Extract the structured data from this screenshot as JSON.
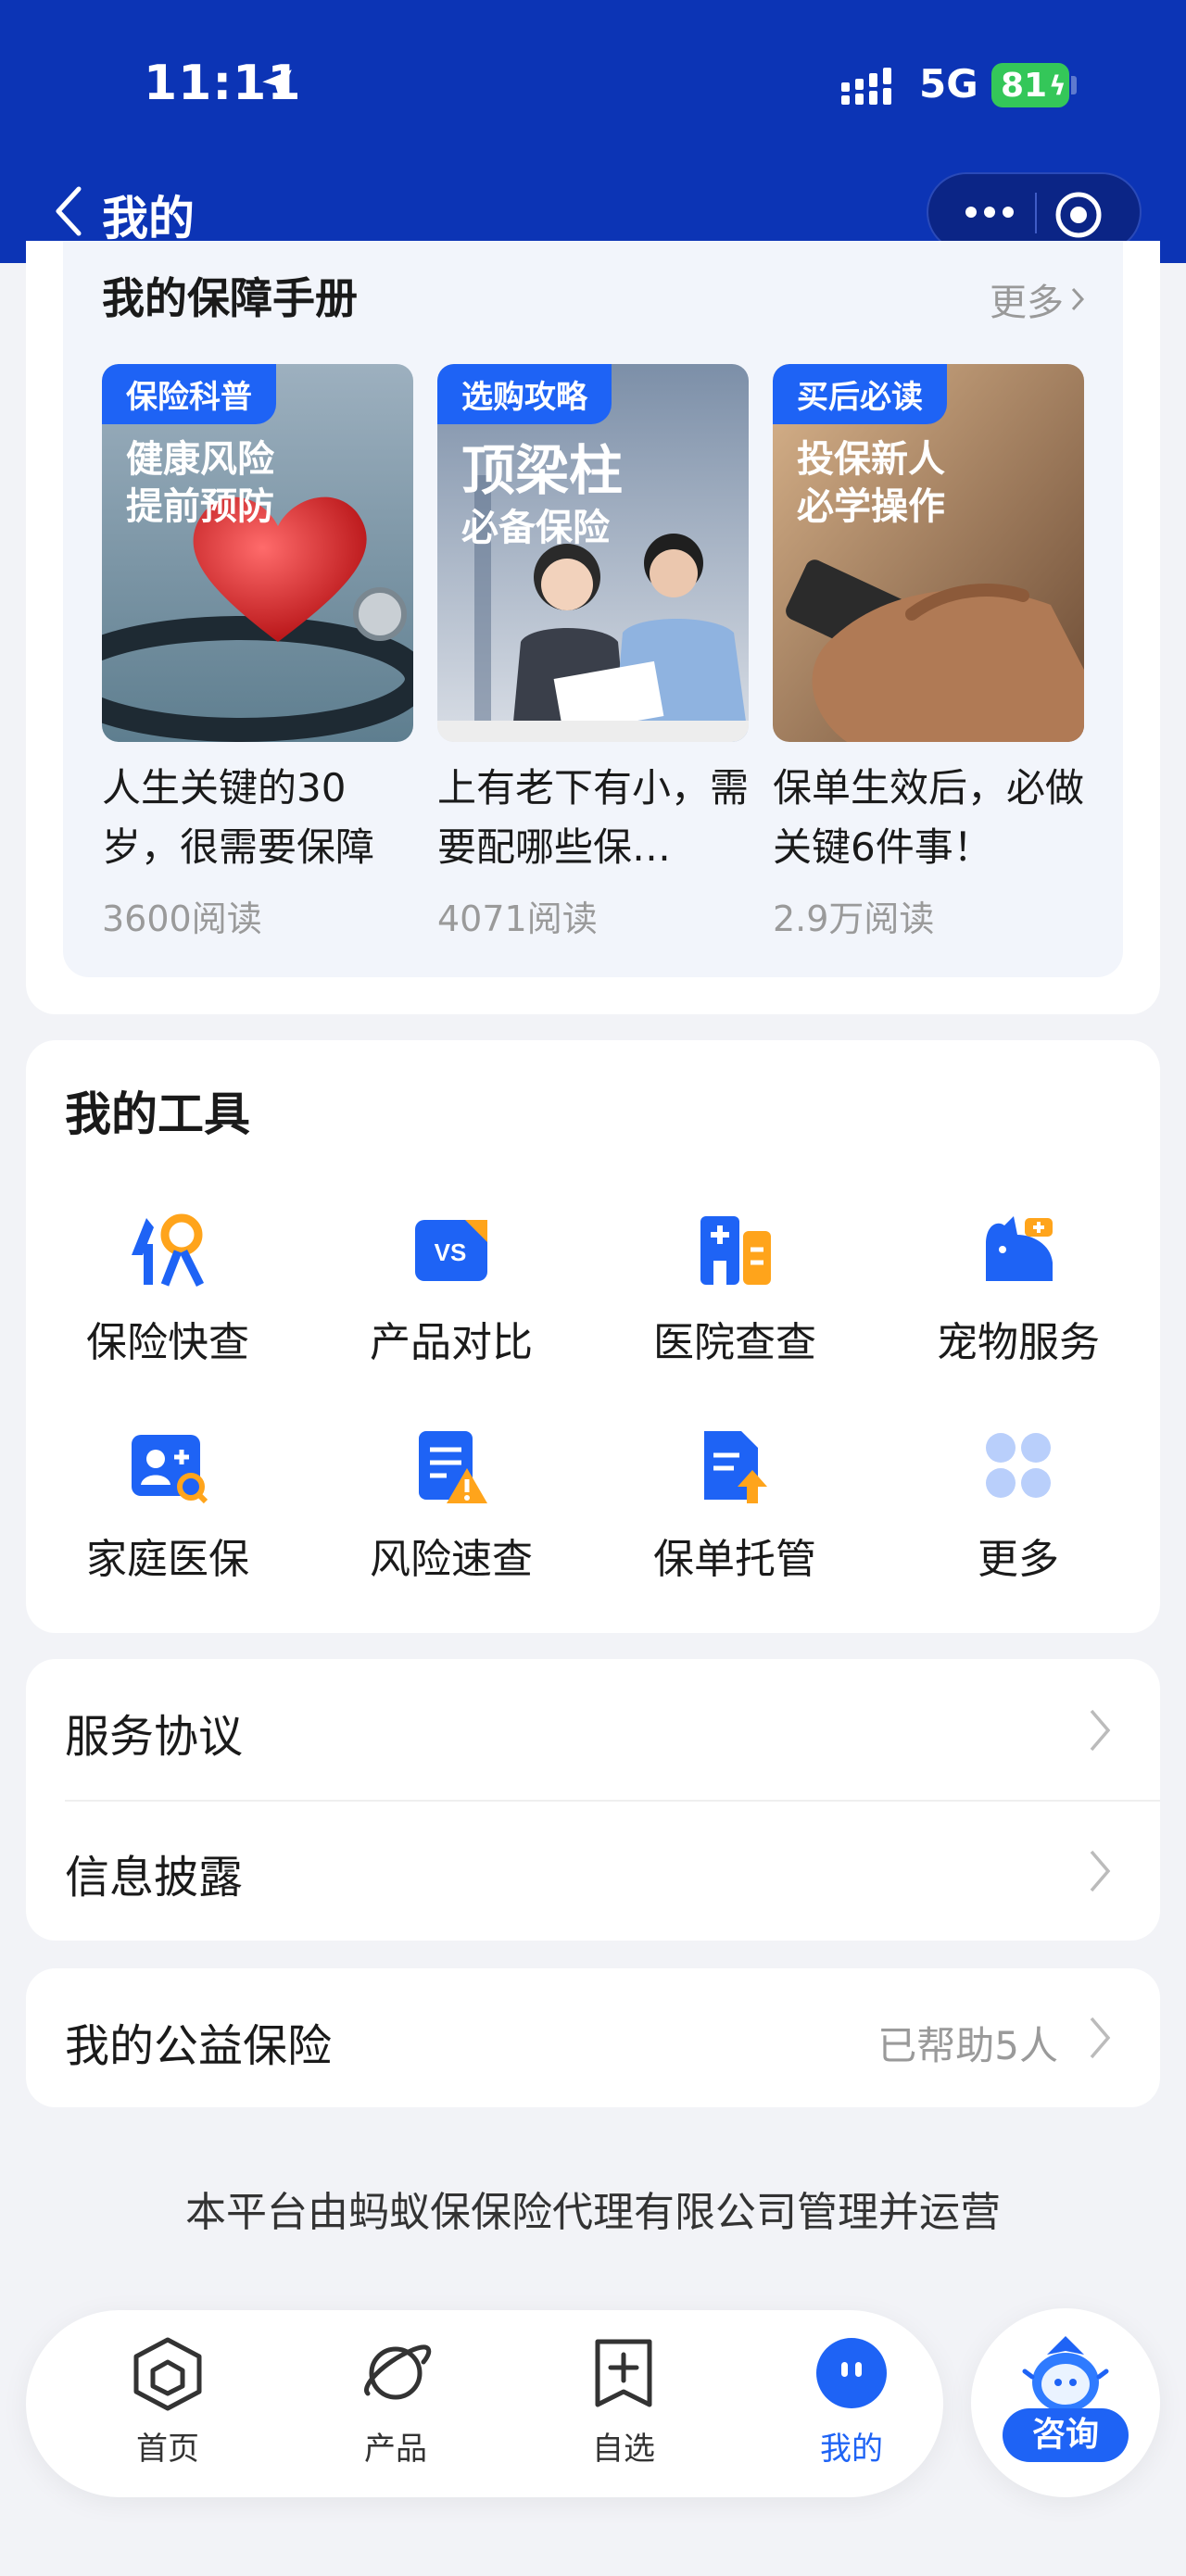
{
  "status_bar": {
    "time": "11:11",
    "network": "5G",
    "battery": "81"
  },
  "nav": {
    "title": "我的"
  },
  "handbook": {
    "title": "我的保障手册",
    "more": "更多",
    "articles": [
      {
        "tag": "保险科普",
        "overlay_lines": [
          "健康风险",
          "提前预防"
        ],
        "title": "人生关键的30岁，很需要保障",
        "reads": "3600阅读"
      },
      {
        "tag": "选购攻略",
        "overlay_lines": [
          "顶梁柱",
          "必备保险"
        ],
        "title": "上有老下有小，需要配哪些保…",
        "reads": "4071阅读"
      },
      {
        "tag": "买后必读",
        "overlay_lines": [
          "投保新人",
          "必学操作"
        ],
        "title": "保单生效后，必做关键6件事！",
        "reads": "2.9万阅读"
      }
    ]
  },
  "tools": {
    "title": "我的工具",
    "items": [
      {
        "label": "保险快查",
        "icon": "insurance-lookup-icon"
      },
      {
        "label": "产品对比",
        "icon": "vs-compare-icon"
      },
      {
        "label": "医院查查",
        "icon": "hospital-icon"
      },
      {
        "label": "宠物服务",
        "icon": "pet-icon"
      },
      {
        "label": "家庭医保",
        "icon": "family-medical-icon"
      },
      {
        "label": "风险速查",
        "icon": "risk-check-icon"
      },
      {
        "label": "保单托管",
        "icon": "policy-custody-icon"
      },
      {
        "label": "更多",
        "icon": "more-grid-icon"
      }
    ]
  },
  "links": {
    "service_agreement": "服务协议",
    "info_disclosure": "信息披露"
  },
  "charity": {
    "label": "我的公益保险",
    "extra": "已帮助5人"
  },
  "footer": "本平台由蚂蚁保保险代理有限公司管理并运营",
  "tabbar": {
    "tabs": [
      {
        "label": "首页",
        "icon": "home-icon"
      },
      {
        "label": "产品",
        "icon": "planet-icon"
      },
      {
        "label": "自选",
        "icon": "add-box-icon"
      },
      {
        "label": "我的",
        "icon": "profile-face-icon"
      }
    ],
    "consult": "咨询"
  },
  "colors": {
    "header": "#0C34B5",
    "accent": "#1E63F5",
    "background": "#F2F3F7"
  }
}
